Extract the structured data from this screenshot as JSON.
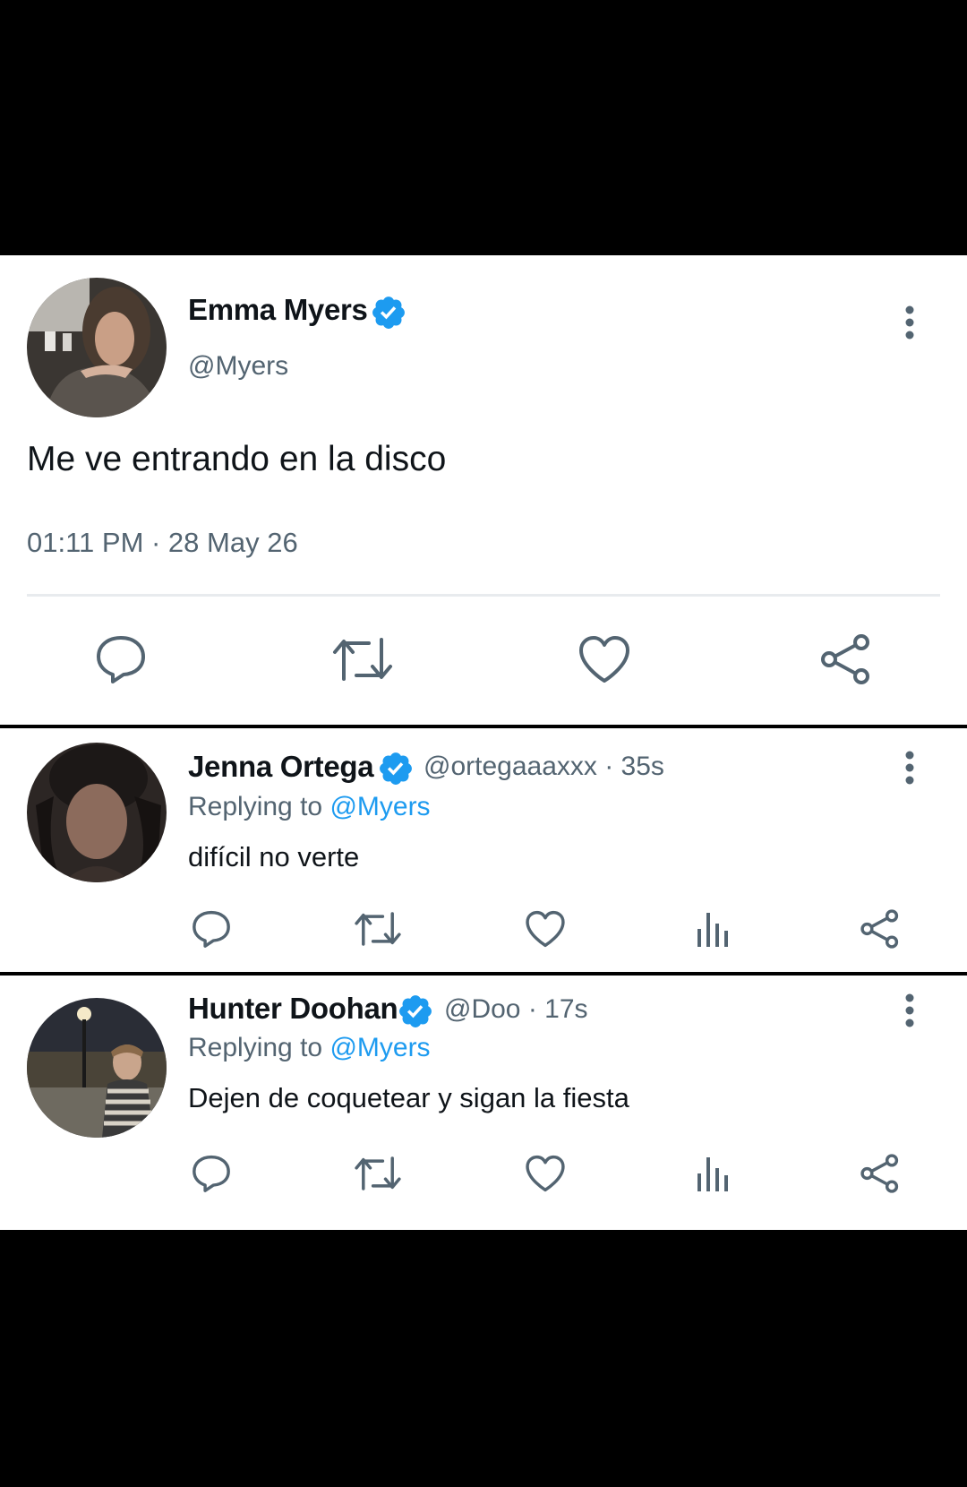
{
  "main_tweet": {
    "author_name": "Emma Myers",
    "author_handle": "@Myers",
    "text": "Me ve entrando en la disco",
    "timestamp": "01:11 PM · 28 May 26",
    "avatar_icon": "avatar-photo",
    "verified_icon": "verified-badge-icon",
    "actions": [
      "reply-icon",
      "retweet-icon",
      "like-icon",
      "share-icon"
    ]
  },
  "replies": [
    {
      "author_name": "Jenna Ortega",
      "author_handle": "@ortegaaaxxx",
      "time_ago": "· 35s",
      "replying_prefix": "Replying to",
      "replying_to": "@Myers",
      "text": "difícil no verte",
      "actions": [
        "reply-icon",
        "retweet-icon",
        "like-icon",
        "analytics-icon",
        "share-icon"
      ]
    },
    {
      "author_name": "Hunter Doohan",
      "author_handle": "@Doo",
      "time_ago": "· 17s",
      "replying_prefix": "Replying to",
      "replying_to": "@Myers",
      "text": "Dejen de coquetear y sigan la fiesta",
      "actions": [
        "reply-icon",
        "retweet-icon",
        "like-icon",
        "analytics-icon",
        "share-icon"
      ]
    }
  ],
  "colors": {
    "background": "#000000",
    "card": "#ffffff",
    "text": "#0f1419",
    "secondary_text": "#536471",
    "accent": "#1d9bf0",
    "divider": "#e8ebee"
  }
}
